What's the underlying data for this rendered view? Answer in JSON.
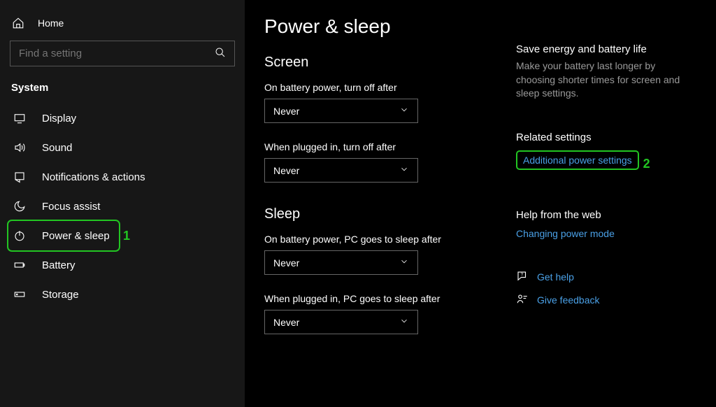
{
  "sidebar": {
    "home_label": "Home",
    "search_placeholder": "Find a setting",
    "section_label": "System",
    "items": [
      {
        "label": "Display"
      },
      {
        "label": "Sound"
      },
      {
        "label": "Notifications & actions"
      },
      {
        "label": "Focus assist"
      },
      {
        "label": "Power & sleep"
      },
      {
        "label": "Battery"
      },
      {
        "label": "Storage"
      }
    ]
  },
  "annotations": {
    "one": "1",
    "two": "2"
  },
  "main": {
    "title": "Power & sleep",
    "screen": {
      "heading": "Screen",
      "battery_label": "On battery power, turn off after",
      "battery_value": "Never",
      "plugged_label": "When plugged in, turn off after",
      "plugged_value": "Never"
    },
    "sleep": {
      "heading": "Sleep",
      "battery_label": "On battery power, PC goes to sleep after",
      "battery_value": "Never",
      "plugged_label": "When plugged in, PC goes to sleep after",
      "plugged_value": "Never"
    }
  },
  "aside": {
    "save_title": "Save energy and battery life",
    "save_desc": "Make your battery last longer by choosing shorter times for screen and sleep settings.",
    "related_title": "Related settings",
    "related_link": "Additional power settings",
    "help_title": "Help from the web",
    "help_link": "Changing power mode",
    "get_help": "Get help",
    "feedback": "Give feedback"
  }
}
